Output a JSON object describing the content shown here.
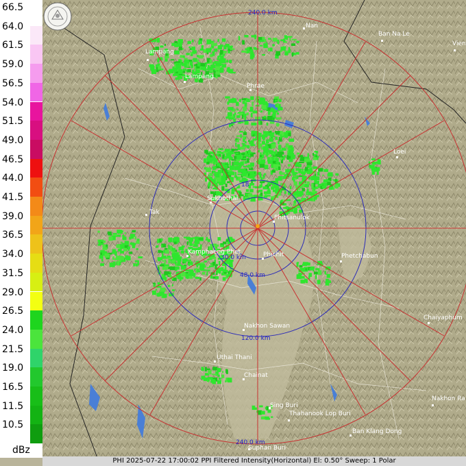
{
  "legend": {
    "unit": "dBz",
    "levels": [
      {
        "label": "66.5",
        "color": "#ffffff"
      },
      {
        "label": "64.0",
        "color": "#fbe8f8"
      },
      {
        "label": "61.5",
        "color": "#f9c6f3"
      },
      {
        "label": "59.0",
        "color": "#f59cee"
      },
      {
        "label": "56.5",
        "color": "#f066e6"
      },
      {
        "label": "54.0",
        "color": "#e8149e"
      },
      {
        "label": "51.5",
        "color": "#d80f80"
      },
      {
        "label": "49.0",
        "color": "#c90c62"
      },
      {
        "label": "46.5",
        "color": "#ee1010"
      },
      {
        "label": "44.0",
        "color": "#f24d12"
      },
      {
        "label": "41.5",
        "color": "#f38a18"
      },
      {
        "label": "39.0",
        "color": "#f2a518"
      },
      {
        "label": "36.5",
        "color": "#eec21a"
      },
      {
        "label": "34.0",
        "color": "#e6dd14"
      },
      {
        "label": "31.5",
        "color": "#d7ef13"
      },
      {
        "label": "29.0",
        "color": "#f3ff12"
      },
      {
        "label": "26.5",
        "color": "#1ed51e"
      },
      {
        "label": "24.0",
        "color": "#4be43c"
      },
      {
        "label": "21.5",
        "color": "#2fd46a"
      },
      {
        "label": "19.0",
        "color": "#22c82d"
      },
      {
        "label": "16.5",
        "color": "#18be18"
      },
      {
        "label": "11.5",
        "color": "#13b313"
      },
      {
        "label": "10.5",
        "color": "#0f9d0f"
      }
    ]
  },
  "rings": [
    {
      "label": "240.0 km",
      "color": "#c83030"
    },
    {
      "label": "120.0 km",
      "color": "#2a2ab8"
    },
    {
      "label": "48.0 km",
      "color": "#2a2ab8"
    },
    {
      "label": "30.0 km",
      "color": "#2a2ab8"
    },
    {
      "label": "18",
      "color": "#2a2ab8"
    }
  ],
  "cities": [
    "Nan",
    "Ban Na Le",
    "Vien",
    "Lampang",
    "Lampang",
    "Phrae",
    "Loei",
    "Sukhothai",
    "Tak",
    "Phitsanulok",
    "Kamphaeng Phet",
    "Phichit",
    "Phetchabun",
    "Nakhon Sawan",
    "Chaiyaphum",
    "Uthai Thani",
    "Chainat",
    "Nakhon Ra",
    "Sing Buri",
    "Thahanook Lop Buri",
    "Ban Klang Dong",
    "Suphan Buri"
  ],
  "status_bar": "PHI 2025-07-22 17:00:02 PPI Filtered Intensity(Horizontal)  El: 0.50°  Sweep: 1 Polar",
  "logo_text": "Thai Meteorological Department",
  "colors": {
    "terrain": "#b3ae8e",
    "rain": "#2ee62e",
    "river": "#4a7fd6",
    "polar_red": "#d43a2a",
    "polar_blue": "#2a2ab8"
  }
}
